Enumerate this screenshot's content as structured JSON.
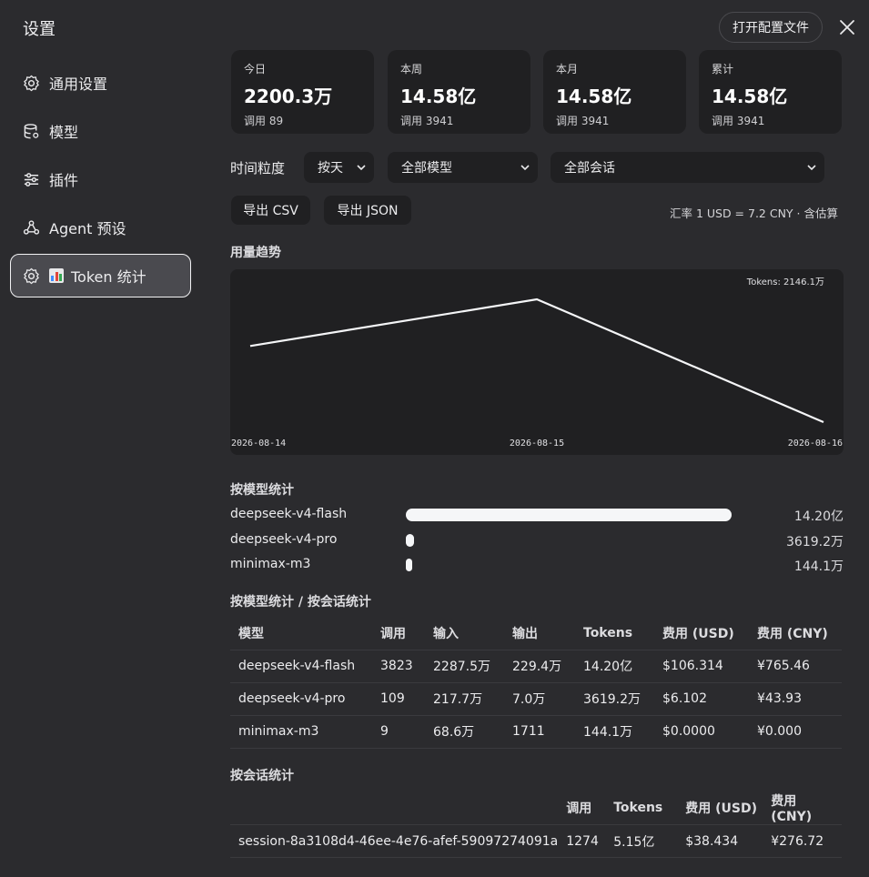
{
  "header": {
    "title": "设置",
    "open_config": "打开配置文件"
  },
  "sidebar": {
    "items": [
      {
        "label": "通用设置",
        "icon": "gear-icon"
      },
      {
        "label": "模型",
        "icon": "database-icon"
      },
      {
        "label": "插件",
        "icon": "sliders-icon"
      },
      {
        "label": "Agent 预设",
        "icon": "agent-icon"
      },
      {
        "label": "Token 统计",
        "icon": "bar-chart-emoji",
        "active": true
      }
    ]
  },
  "stats": [
    {
      "label": "今日",
      "value": "2200.3万",
      "sub": "调用 89"
    },
    {
      "label": "本周",
      "value": "14.58亿",
      "sub": "调用 3941"
    },
    {
      "label": "本月",
      "value": "14.58亿",
      "sub": "调用 3941"
    },
    {
      "label": "累计",
      "value": "14.58亿",
      "sub": "调用 3941"
    }
  ],
  "filters": {
    "label": "时间粒度",
    "granularity": "按天",
    "model": "全部模型",
    "session": "全部会话"
  },
  "buttons": {
    "export_csv": "导出 CSV",
    "export_json": "导出 JSON"
  },
  "rate_note": "汇率 1 USD = 7.2 CNY · 含估算",
  "trend": {
    "title": "用量趋势",
    "tooltip": "Tokens: 2146.1万"
  },
  "chart_data": {
    "type": "line",
    "x": [
      "2026-08-14",
      "2026-08-15",
      "2026-08-16"
    ],
    "series": [
      {
        "values": [
          0.62,
          1.0,
          0.0
        ]
      }
    ],
    "annotations": [
      "Tokens: 2146.1万"
    ],
    "grid": false
  },
  "by_model_bars": {
    "title": "按模型统计",
    "rows": [
      {
        "name": "deepseek-v4-flash",
        "value": "14.20亿",
        "fraction": 1.0
      },
      {
        "name": "deepseek-v4-pro",
        "value": "3619.2万",
        "fraction": 0.0255
      },
      {
        "name": "minimax-m3",
        "value": "144.1万",
        "fraction": 0.001
      }
    ]
  },
  "model_table": {
    "title": "按模型统计 / 按会话统计",
    "headers": [
      "模型",
      "调用",
      "输入",
      "输出",
      "Tokens",
      "费用 (USD)",
      "费用 (CNY)"
    ],
    "rows": [
      [
        "deepseek-v4-flash",
        "3823",
        "2287.5万",
        "229.4万",
        "14.20亿",
        "$106.314",
        "¥765.46"
      ],
      [
        "deepseek-v4-pro",
        "109",
        "217.7万",
        "7.0万",
        "3619.2万",
        "$6.102",
        "¥43.93"
      ],
      [
        "minimax-m3",
        "9",
        "68.6万",
        "1711",
        "144.1万",
        "$0.0000",
        "¥0.000"
      ]
    ]
  },
  "session_table": {
    "title": "按会话统计",
    "headers": [
      "",
      "调用",
      "Tokens",
      "费用 (USD)",
      "费用 (CNY)"
    ],
    "rows": [
      [
        "session-8a3108d4-46ee-4e76-afef-59097274091a",
        "1274",
        "5.15亿",
        "$38.434",
        "¥276.72"
      ]
    ]
  }
}
